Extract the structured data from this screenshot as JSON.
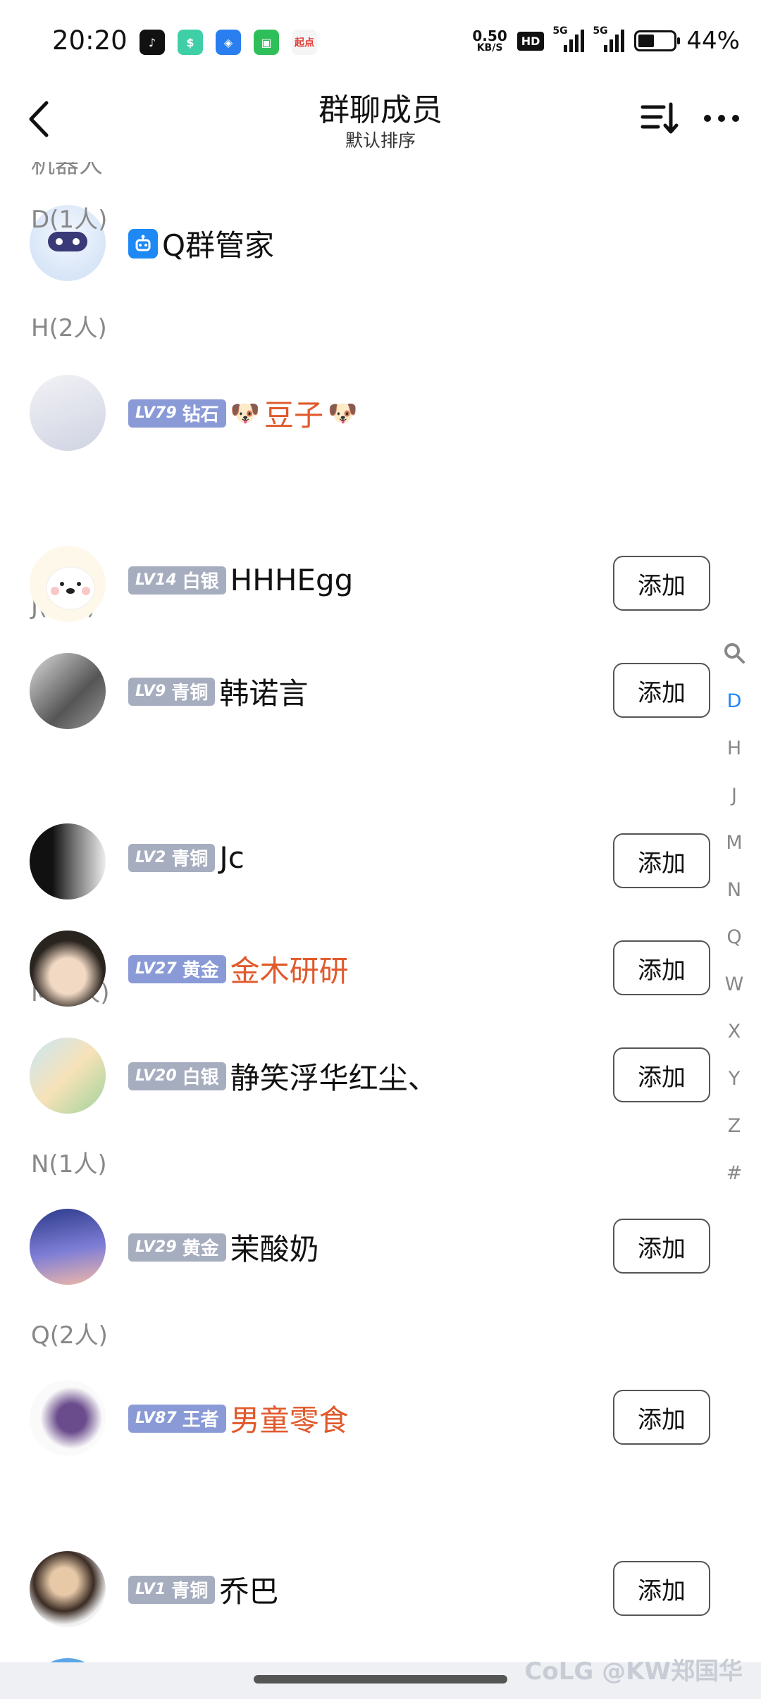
{
  "status_bar": {
    "time": "20:20",
    "speed_value": "0.50",
    "speed_unit": "KB/S",
    "hd": "HD",
    "signal1": "5G",
    "signal2": "5G",
    "battery_text": "44%",
    "app_icons": [
      "douyin-icon",
      "wallet-icon",
      "shield-app-icon",
      "message-app-icon",
      "qidian-icon"
    ],
    "qidian_label": "起点"
  },
  "header": {
    "title": "群聊成员",
    "subtitle": "默认排序"
  },
  "list": {
    "cut_section": "机器人",
    "bot": {
      "name": "Q群管家"
    },
    "sections": [
      {
        "label": "D(1人)"
      },
      {
        "label": "H(2人)"
      },
      {
        "label": "J(3人)"
      },
      {
        "label": "M(1人)"
      },
      {
        "label": "N(1人)"
      },
      {
        "label": "Q(2人)"
      }
    ],
    "members": [
      {
        "lv": "LV79",
        "rank": "钻石",
        "name": "豆子",
        "badge_color": "#8a9ad6",
        "red": true,
        "has_add": false
      },
      {
        "lv": "LV14",
        "rank": "白银",
        "name": "HHHEgg",
        "badge_color": "#a6adbf",
        "red": false,
        "has_add": true
      },
      {
        "lv": "LV9",
        "rank": "青铜",
        "name": "韩诺言",
        "badge_color": "#a6adbf",
        "red": false,
        "has_add": true
      },
      {
        "lv": "LV2",
        "rank": "青铜",
        "name": "Jc",
        "badge_color": "#a6adbf",
        "red": false,
        "has_add": true
      },
      {
        "lv": "LV27",
        "rank": "黄金",
        "name": "金木研研",
        "badge_color": "#8a9ad6",
        "red": true,
        "has_add": true
      },
      {
        "lv": "LV20",
        "rank": "白银",
        "name": "静笑浮华红尘、",
        "badge_color": "#a6adbf",
        "red": false,
        "has_add": true
      },
      {
        "lv": "LV29",
        "rank": "黄金",
        "name": "茉酸奶",
        "badge_color": "#a6adbf",
        "red": false,
        "has_add": true
      },
      {
        "lv": "LV87",
        "rank": "王者",
        "name": "男童零食",
        "badge_color": "#8a9ad6",
        "red": true,
        "has_add": true
      },
      {
        "lv": "LV1",
        "rank": "青铜",
        "name": "乔巴",
        "badge_color": "#a6adbf",
        "red": false,
        "has_add": true
      }
    ],
    "add_label": "添加"
  },
  "index_bar": {
    "letters": [
      "D",
      "H",
      "J",
      "M",
      "N",
      "Q",
      "W",
      "X",
      "Y",
      "Z",
      "#"
    ],
    "active": "D"
  },
  "watermark": "CoLG @KW郑国华",
  "colors": {
    "accent": "#1e88f5",
    "red_name": "#e05a2c",
    "section_gray": "#888888"
  }
}
